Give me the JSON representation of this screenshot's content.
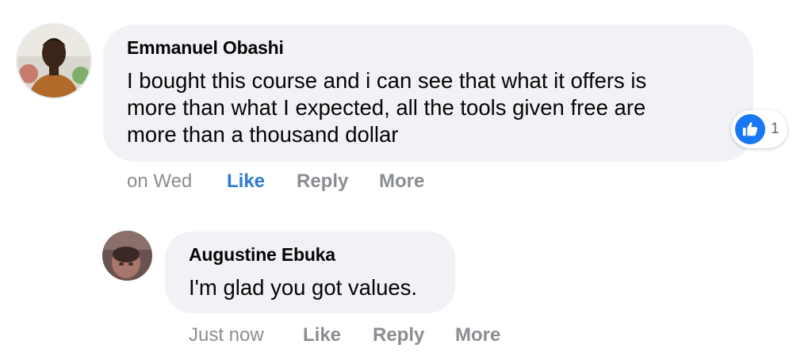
{
  "comments": [
    {
      "author": "Emmanuel Obashi",
      "text_lines": [
        "I bought this course and i can see that what it offers is",
        "more than what I expected, all the tools given free are",
        "more than a thousand dollar"
      ],
      "reaction": {
        "icon": "like-icon",
        "count": "1",
        "color": "#1877f2"
      },
      "timestamp": "on Wed",
      "actions": {
        "like": "Like",
        "reply": "Reply",
        "more": "More"
      },
      "liked": true
    },
    {
      "author": "Augustine Ebuka",
      "text_lines": [
        "I'm glad you got values."
      ],
      "timestamp": "Just now",
      "actions": {
        "like": "Like",
        "reply": "Reply",
        "more": "More"
      },
      "liked": false
    }
  ],
  "colors": {
    "bubble": "#f0f2f5",
    "text": "#050505",
    "muted": "#8a8d91",
    "like_active": "#2d7ad6"
  }
}
